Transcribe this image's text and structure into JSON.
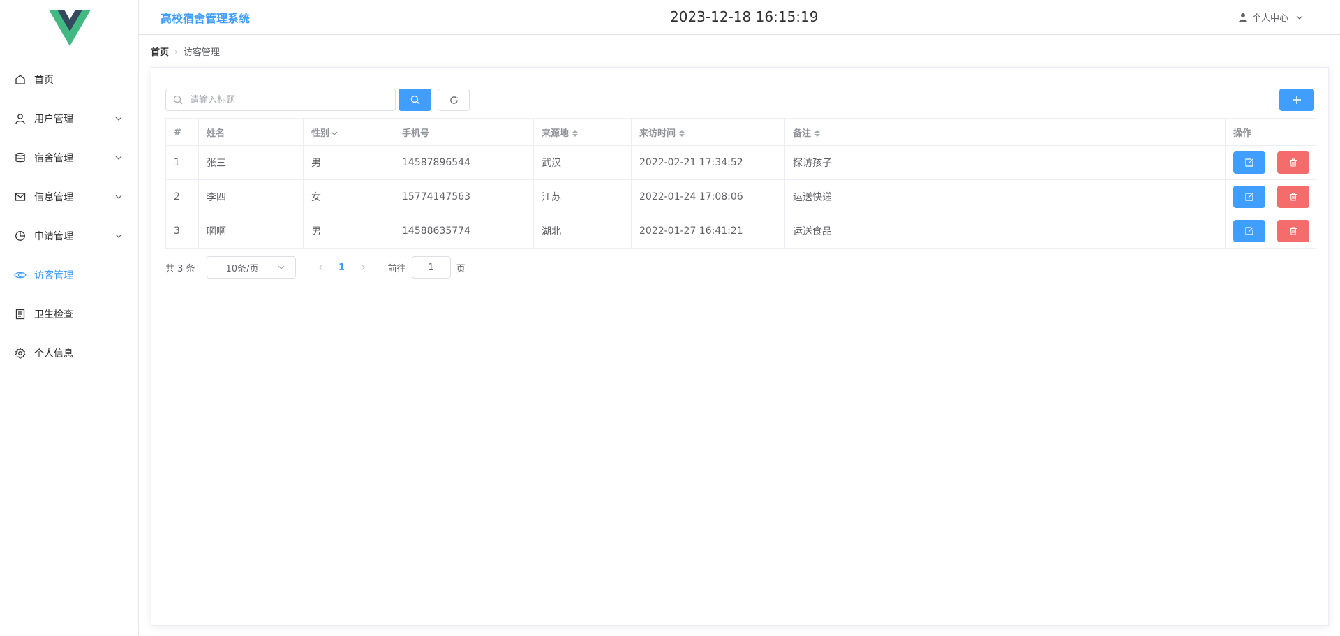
{
  "colors": {
    "accent": "#409eff",
    "danger": "#f56c6c",
    "logo_green": "#42b883",
    "logo_dark": "#35495e"
  },
  "sidebar": {
    "items": [
      {
        "label": "首页",
        "icon": "home-icon",
        "has_submenu": false,
        "active": false
      },
      {
        "label": "用户管理",
        "icon": "user-icon",
        "has_submenu": true,
        "active": false
      },
      {
        "label": "宿舍管理",
        "icon": "database-icon",
        "has_submenu": true,
        "active": false
      },
      {
        "label": "信息管理",
        "icon": "mail-icon",
        "has_submenu": true,
        "active": false
      },
      {
        "label": "申请管理",
        "icon": "pie-chart-icon",
        "has_submenu": true,
        "active": false
      },
      {
        "label": "访客管理",
        "icon": "eye-icon",
        "has_submenu": false,
        "active": true
      },
      {
        "label": "卫生检查",
        "icon": "document-icon",
        "has_submenu": false,
        "active": false
      },
      {
        "label": "个人信息",
        "icon": "gear-icon",
        "has_submenu": false,
        "active": false
      }
    ]
  },
  "header": {
    "app_title": "高校宿舍管理系统",
    "clock": "2023-12-18 16:15:19",
    "user_menu_label": "个人中心"
  },
  "breadcrumb": {
    "home": "首页",
    "current": "访客管理"
  },
  "search": {
    "placeholder": "请输入标题",
    "value": ""
  },
  "table": {
    "columns": [
      "#",
      "姓名",
      "性别",
      "手机号",
      "来源地",
      "来访时间",
      "备注",
      "操作"
    ],
    "rows": [
      [
        "1",
        "张三",
        "男",
        "14587896544",
        "武汉",
        "2022-02-21 17:34:52",
        "探访孩子"
      ],
      [
        "2",
        "李四",
        "女",
        "15774147563",
        "江苏",
        "2022-01-24 17:08:06",
        "运送快递"
      ],
      [
        "3",
        "啊啊",
        "男",
        "14588635774",
        "湖北",
        "2022-01-27 16:41:21",
        "运送食品"
      ]
    ]
  },
  "pagination": {
    "total_text": "共 3 条",
    "page_size": "10条/页",
    "current_page": "1",
    "goto_label": "前往",
    "goto_value": "1",
    "page_unit": "页"
  }
}
